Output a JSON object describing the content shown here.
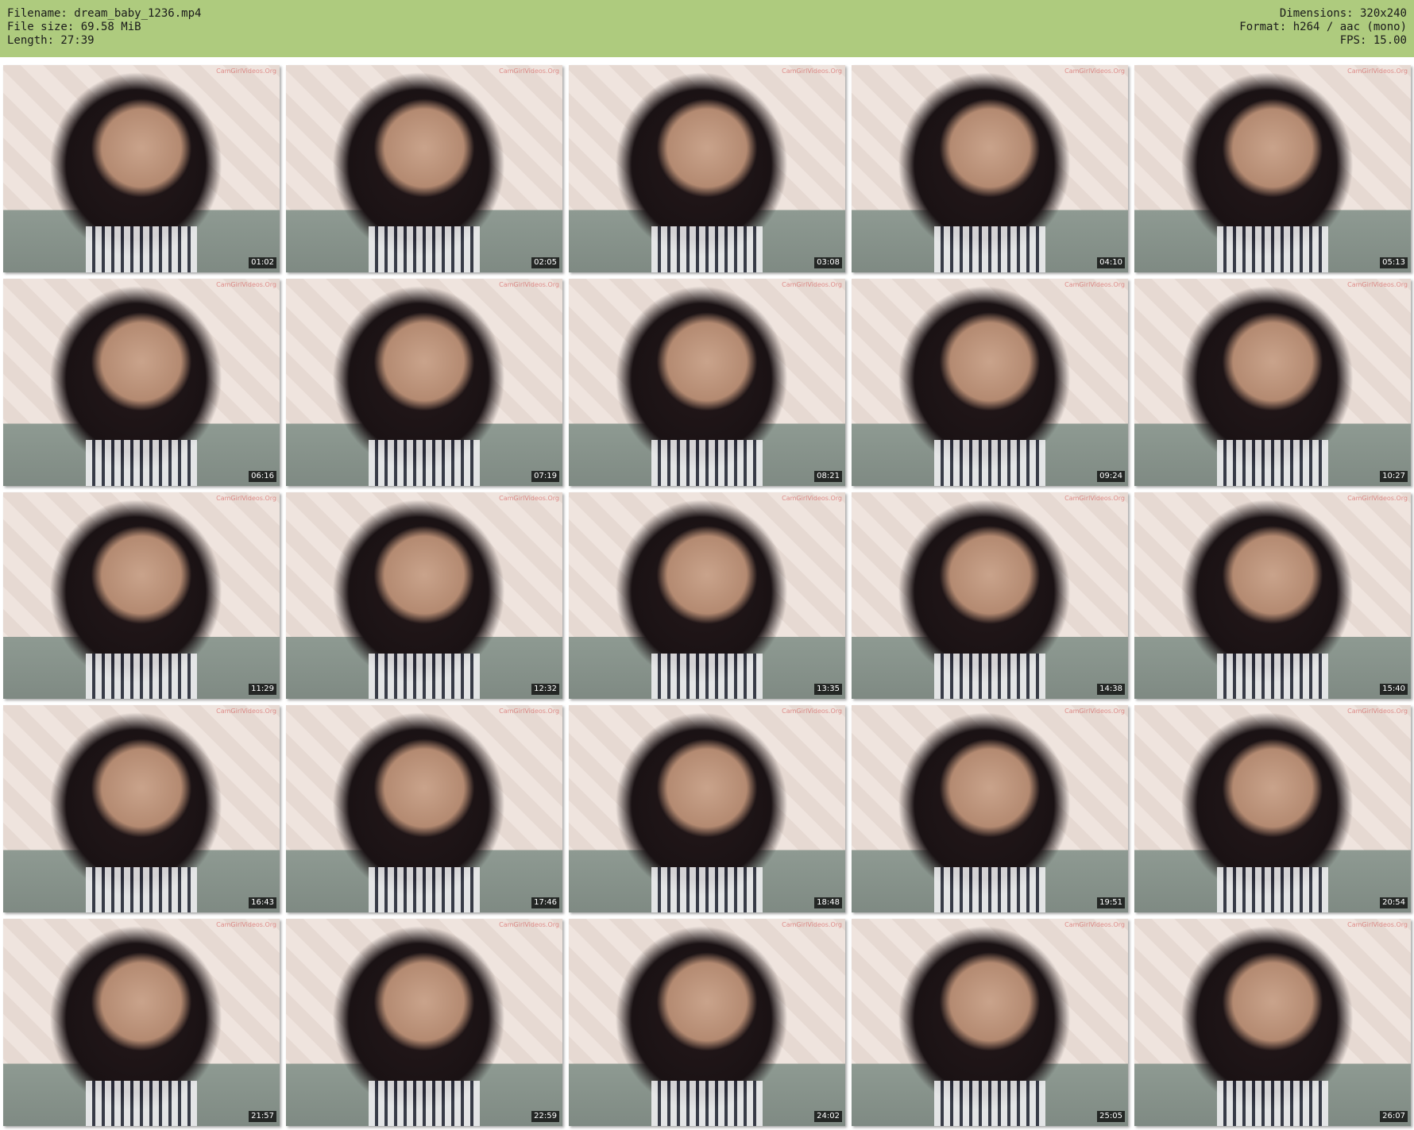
{
  "header": {
    "filename": "Filename: dream_baby_1236.mp4",
    "filesize": "File size: 69.58 MiB",
    "length": "Length: 27:39",
    "dimensions": "Dimensions: 320x240",
    "format": "Format: h264 / aac (mono)",
    "fps": "FPS: 15.00"
  },
  "watermark": "CamGirlVideos.Org",
  "thumbnails": [
    {
      "time": "01:02"
    },
    {
      "time": "02:05"
    },
    {
      "time": "03:08"
    },
    {
      "time": "04:10"
    },
    {
      "time": "05:13"
    },
    {
      "time": "06:16"
    },
    {
      "time": "07:19"
    },
    {
      "time": "08:21"
    },
    {
      "time": "09:24"
    },
    {
      "time": "10:27"
    },
    {
      "time": "11:29"
    },
    {
      "time": "12:32"
    },
    {
      "time": "13:35"
    },
    {
      "time": "14:38"
    },
    {
      "time": "15:40"
    },
    {
      "time": "16:43"
    },
    {
      "time": "17:46"
    },
    {
      "time": "18:48"
    },
    {
      "time": "19:51"
    },
    {
      "time": "20:54"
    },
    {
      "time": "21:57"
    },
    {
      "time": "22:59"
    },
    {
      "time": "24:02"
    },
    {
      "time": "25:05"
    },
    {
      "time": "26:07"
    }
  ],
  "colors": {
    "header_bg": "#aecb7e",
    "timestamp_bg": "#000000"
  }
}
